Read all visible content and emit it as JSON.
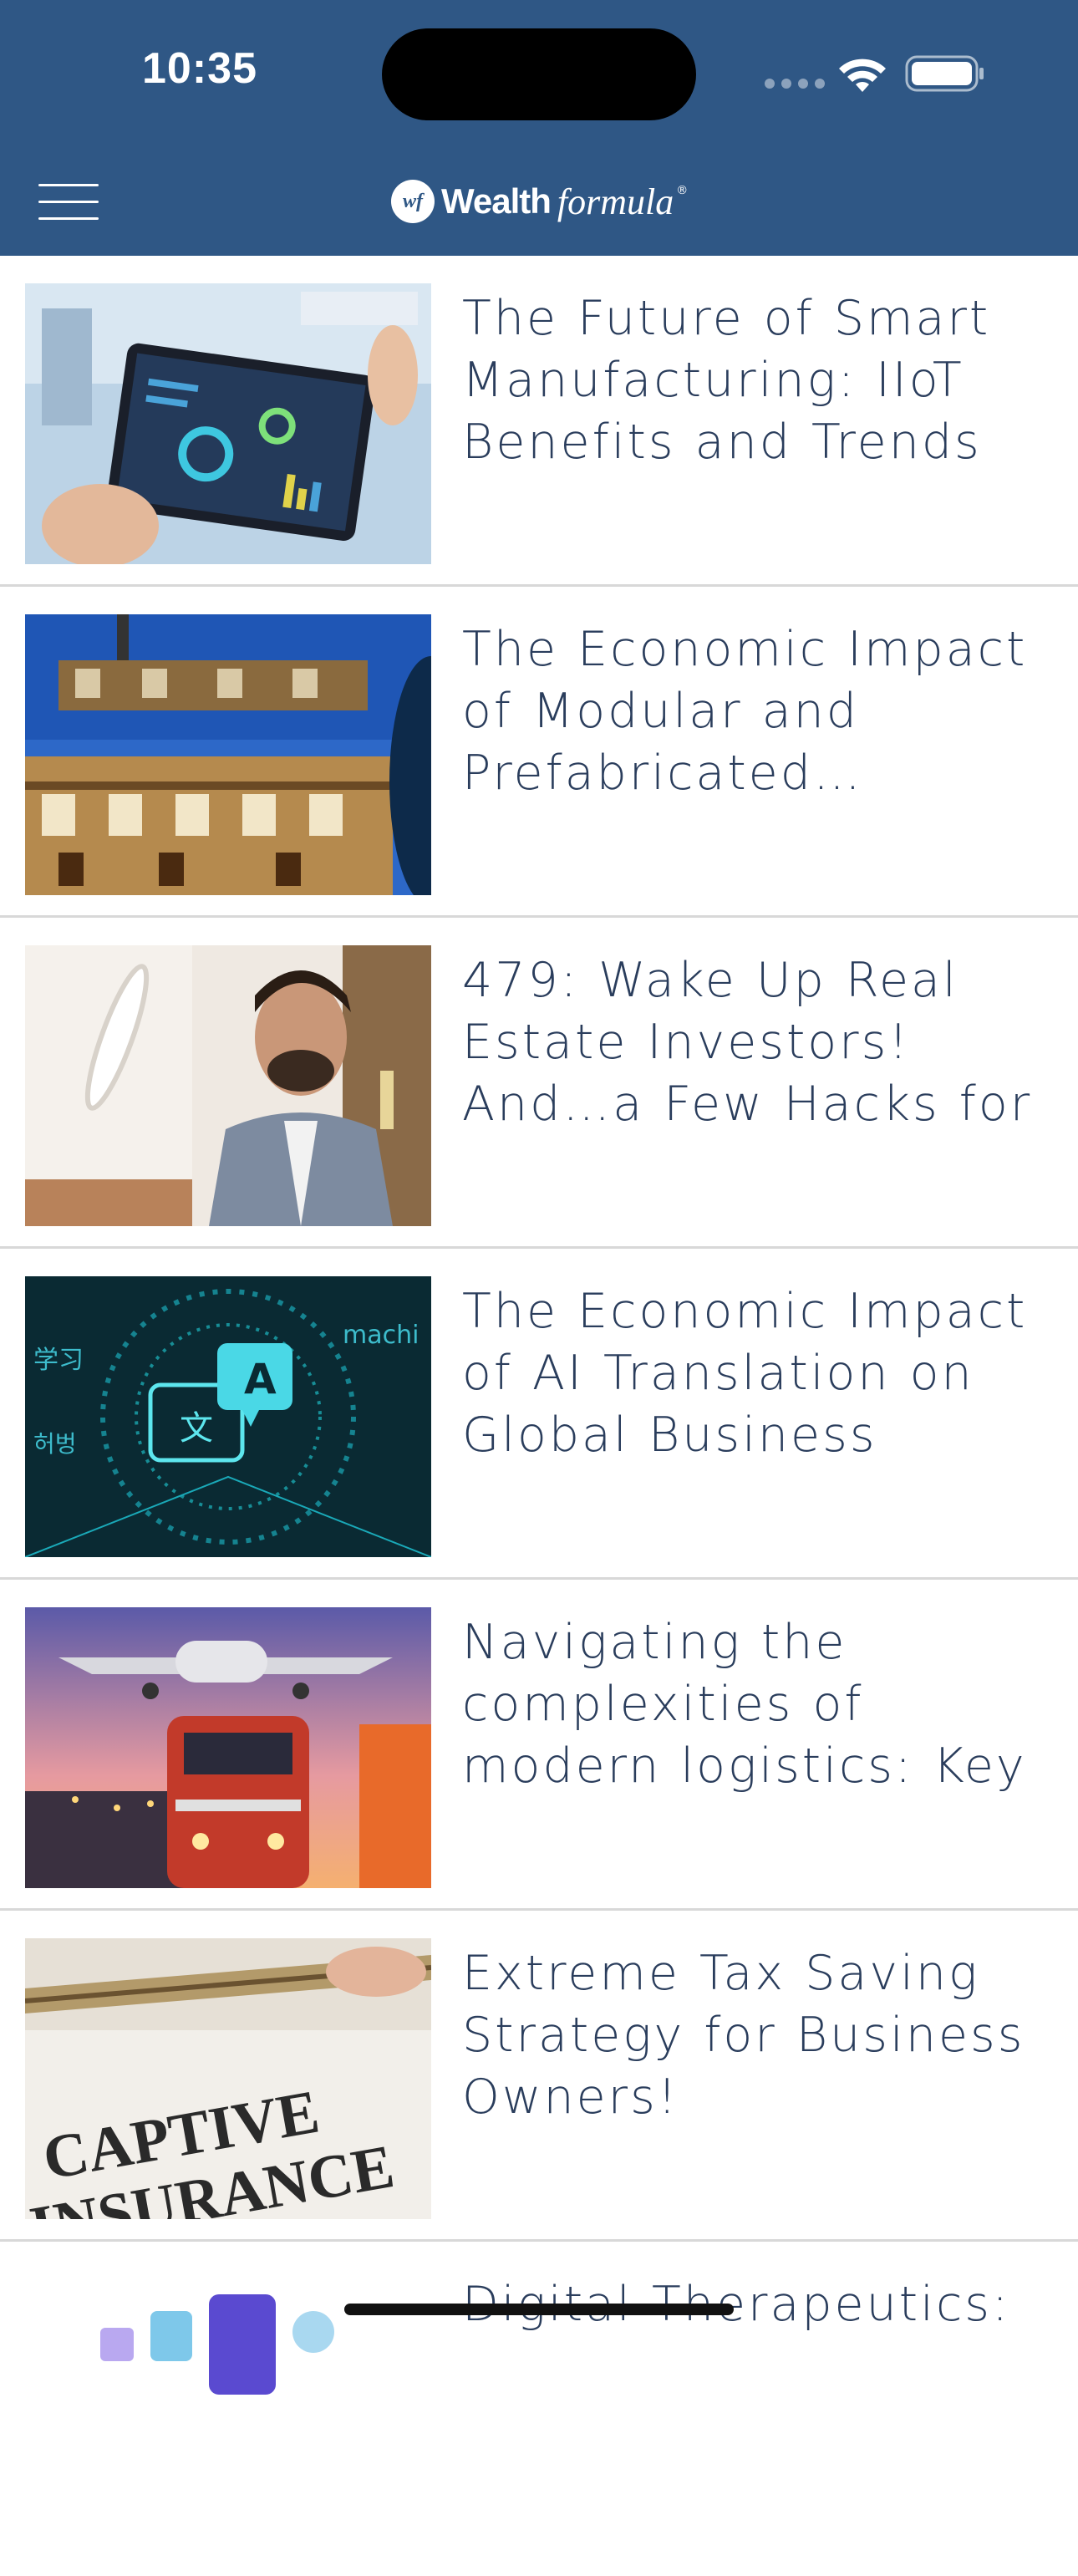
{
  "status_bar": {
    "time": "10:35"
  },
  "header": {
    "menu_icon": "hamburger-menu-icon",
    "logo_mark": "wf",
    "logo_word1": "Wealth",
    "logo_word2": "formula",
    "logo_reg": "®",
    "background_color": "#2f5785"
  },
  "articles": [
    {
      "title": "The Future of Smart Manufacturing: IIoT Benefits and Trends",
      "image": "tablet-dashboard-image"
    },
    {
      "title": "The Economic Impact of Modular and Prefabricated Construction",
      "image": "modular-building-crane-image"
    },
    {
      "title": "479: Wake Up Real Estate Investors! And…a Few Hacks for",
      "image": "man-in-private-jet-image"
    },
    {
      "title": "The Economic Impact of AI Translation on Global Business",
      "image": "ai-translation-hud-image"
    },
    {
      "title": "Navigating the complexities of modern logistics: Key",
      "image": "plane-train-logistics-image"
    },
    {
      "title": "Extreme Tax Saving Strategy for Business Owners!",
      "image": "captive-insurance-clipboard-image"
    },
    {
      "title": "Digital Therapeutics:",
      "image": "digital-therapeutics-image"
    }
  ],
  "colors": {
    "title_text": "#2a3d5c",
    "divider": "#d8d8d8"
  }
}
